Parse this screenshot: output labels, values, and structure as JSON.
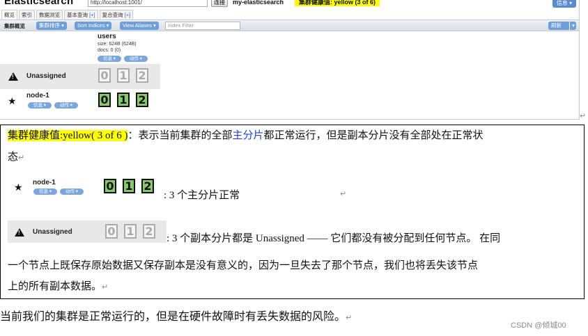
{
  "app": {
    "title": "Elasticsearch",
    "url": "http://localhost:1001/",
    "connect_label": "连接",
    "cluster_name": "my-elasticsearch",
    "health_label": "集群健康值: yellow (3 of 6)",
    "info_menu": "信息 ▾"
  },
  "tabs": [
    {
      "label": "概览",
      "active": true
    },
    {
      "label": "索引",
      "active": false
    },
    {
      "label": "数据浏览",
      "active": false
    },
    {
      "label": "基本查询 ",
      "plus": "[+]",
      "active": false
    },
    {
      "label": "复合查询 ",
      "plus": "[+]",
      "active": false
    }
  ],
  "toolbar": {
    "label": "集群概览",
    "sort_cluster": "集群排序 ▾",
    "sort_indices": "Sort Indices ▾",
    "view_aliases": "View Aliases ▾",
    "filter_placeholder": "Index Filter",
    "refresh": "刷新",
    "refresh_arrow": "▾"
  },
  "index": {
    "name": "users",
    "size": "size: 624B (624B)",
    "docs": "docs: 0 (0)",
    "info": "信息 ▾",
    "action": "动作 ▾"
  },
  "nodes": {
    "unassigned": {
      "label": "Unassigned",
      "shards": [
        "0",
        "1",
        "2"
      ]
    },
    "node1": {
      "label": "node-1",
      "info": "信息 ▾",
      "action": "动作 ▾",
      "shards": [
        "0",
        "1",
        "2"
      ]
    }
  },
  "doc": {
    "health_highlight": "集群健康值:yellow( 3 of 6 )",
    "line1_a": "：表示当前集群的全部",
    "line1_link": "主分片",
    "line1_b": "都正常运行，但是副本分片没有全部处在正常状",
    "line2": "态",
    "node_caption": ": 3 个主分片正常",
    "unassigned_caption": ": 3 个副本分片都是 Unassigned —— 它们都没有被分配到任何节点。 在同",
    "line4": "一个节点上既保存原始数据又保存副本是没有意义的，因为一旦失去了那个节点，我们也将丢失该节点",
    "line5": "上的所有副本数据。"
  },
  "footer": {
    "text": "当前我们的集群是正常运行的，但是在硬件故障时有丢失数据的风险。",
    "watermark": "CSDN @倾城00"
  },
  "para_mark": "↵",
  "colors": {
    "health_yellow": "#ffff00",
    "primary_shard": "#88c86f",
    "button_blue": "#6f9fd8",
    "link_blue": "#2244cc"
  }
}
